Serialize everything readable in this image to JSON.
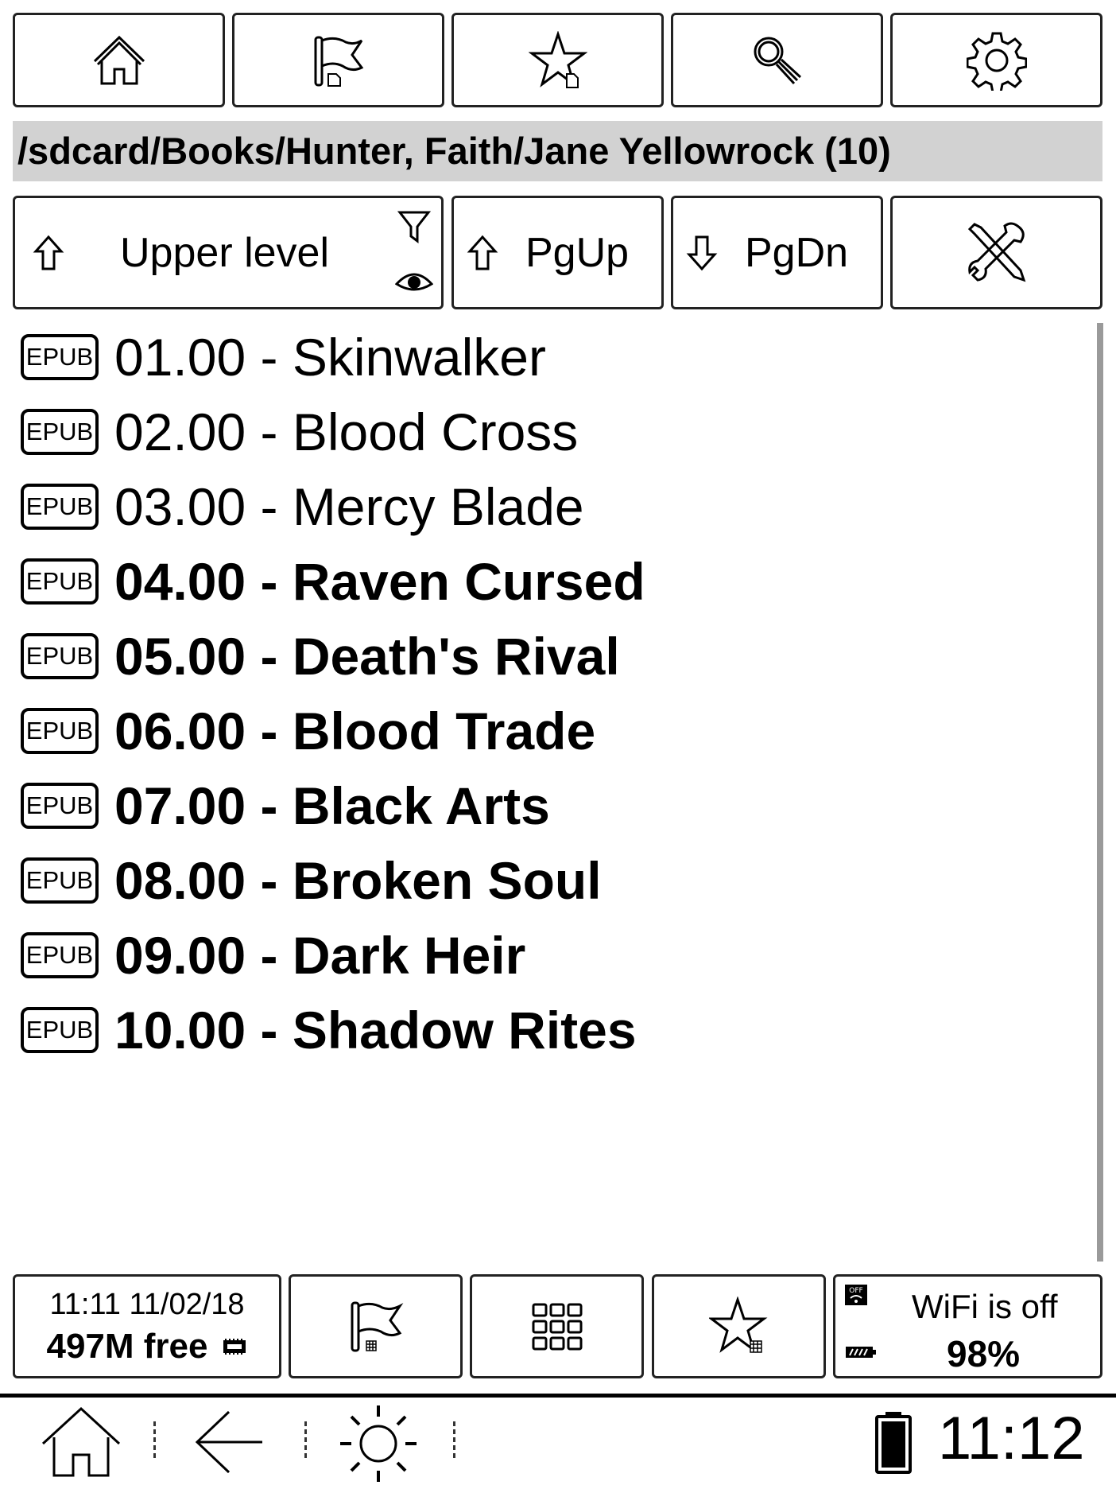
{
  "toolbar": {
    "buttons": [
      {
        "name": "home",
        "icon": "home-icon"
      },
      {
        "name": "bookmarks",
        "icon": "flag-document-icon"
      },
      {
        "name": "favorites",
        "icon": "star-document-icon"
      },
      {
        "name": "search",
        "icon": "search-icon"
      },
      {
        "name": "settings",
        "icon": "gear-icon"
      }
    ]
  },
  "path": "/sdcard/Books/Hunter, Faith/Jane Yellowrock (10)",
  "nav": {
    "upper_level_label": "Upper level",
    "pgup_label": "PgUp",
    "pgdn_label": "PgDn"
  },
  "files": [
    {
      "badge": "EPUB",
      "title": "01.00 - Skinwalker",
      "bold": false
    },
    {
      "badge": "EPUB",
      "title": "02.00 - Blood Cross",
      "bold": false
    },
    {
      "badge": "EPUB",
      "title": "03.00 - Mercy Blade",
      "bold": false
    },
    {
      "badge": "EPUB",
      "title": "04.00 - Raven Cursed",
      "bold": true
    },
    {
      "badge": "EPUB",
      "title": "05.00 - Death's Rival",
      "bold": true
    },
    {
      "badge": "EPUB",
      "title": "06.00 - Blood Trade",
      "bold": true
    },
    {
      "badge": "EPUB",
      "title": "07.00 - Black Arts",
      "bold": true
    },
    {
      "badge": "EPUB",
      "title": "08.00 - Broken Soul",
      "bold": true
    },
    {
      "badge": "EPUB",
      "title": "09.00 - Dark Heir",
      "bold": true
    },
    {
      "badge": "EPUB",
      "title": "10.00 - Shadow Rites",
      "bold": true
    }
  ],
  "status": {
    "datetime": "11:11 11/02/18",
    "free_space": "497M free",
    "wifi": "WiFi is off",
    "battery": "98%"
  },
  "system_bar": {
    "clock": "11:12"
  },
  "colors": {
    "path_bar_bg": "#d2d2d2",
    "border": "#222222"
  }
}
